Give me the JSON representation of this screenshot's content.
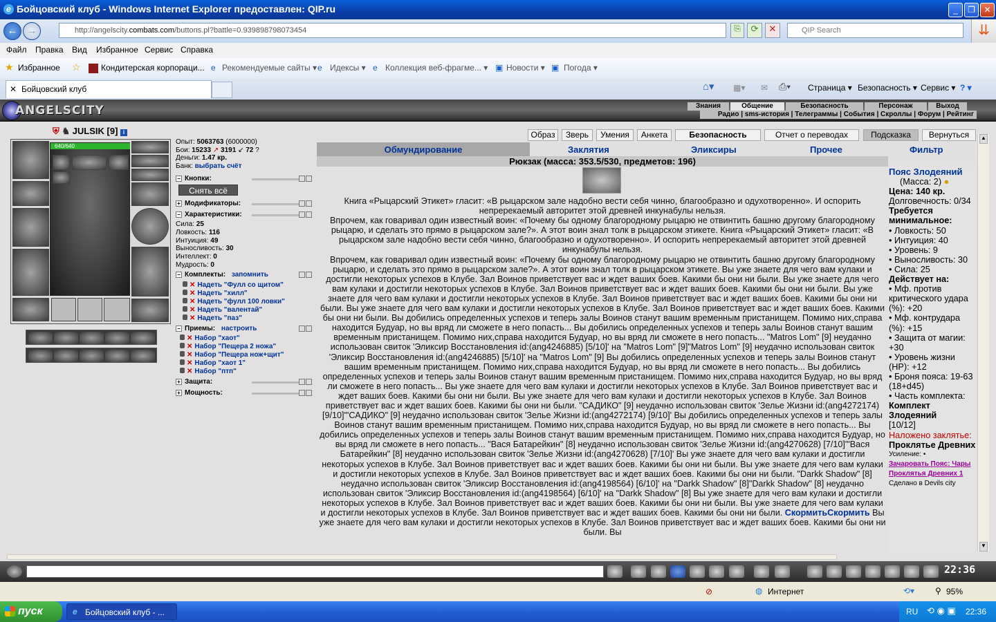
{
  "window": {
    "title": "Бойцовский клуб - Windows Internet Explorer предоставлен: QIP.ru",
    "min": "_",
    "max": "❐",
    "close": "✕"
  },
  "address": {
    "url_prefix": "http://angelscity.",
    "url_domain": "combats.com",
    "url_rest": "/buttons.pl?battle=0.939898798073454",
    "search_placeholder": "QIP Search"
  },
  "menu": [
    "Файл",
    "Правка",
    "Вид",
    "Избранное",
    "Сервис",
    "Справка"
  ],
  "favorites": {
    "label": "Избранное",
    "items": [
      "Кондитерская корпораци...",
      "Рекомендуемые сайты ▾",
      "Идексы ▾",
      "Коллекция веб-фрагме... ▾",
      "Новости ▾",
      "Погода ▾"
    ]
  },
  "tab": {
    "label": "Бойцовский клуб"
  },
  "commandbar": [
    "Страница ▾",
    "Безопасность ▾",
    "Сервис ▾",
    "? ▾"
  ],
  "game": {
    "logo": "ANGELSCITY",
    "topnav": [
      "Знания",
      "Общение",
      "Безопасность",
      "Персонаж",
      "Выход"
    ],
    "subnav": "Радио | sms-история | Телеграммы | События | Скроллы | Форум | Рейтинг",
    "player": {
      "name": "JULSIK",
      "level": "[9]",
      "hp": "640/640"
    },
    "stats": {
      "exp_label": "Опыт:",
      "exp": "5063763",
      "exp_next": "(6000000)",
      "fights_label": "Бои:",
      "wins": "15233",
      "losses": "3191",
      "draws": "72",
      "money_label": "Деньги:",
      "money": "1.47 кр.",
      "bank_label": "Банк:",
      "bank": "выбрать счёт"
    },
    "sections": {
      "buttons": "Кнопки:",
      "remove_all": "Снять всё",
      "modifiers": "Модификаторы:",
      "characteristics": "Характеристики:",
      "sets": "Комплекты:",
      "sets_remember": "запомнить",
      "tricks": "Приемы:",
      "tricks_config": "настроить",
      "defense": "Защита:",
      "power": "Мощность:"
    },
    "attributes": [
      {
        "label": "Сила:",
        "value": "25"
      },
      {
        "label": "Ловкость:",
        "value": "116"
      },
      {
        "label": "Интуиция:",
        "value": "49"
      },
      {
        "label": "Выносливость:",
        "value": "30"
      },
      {
        "label": "Интеллект:",
        "value": "0"
      },
      {
        "label": "Мудрость:",
        "value": "0"
      }
    ],
    "sets": [
      "Надеть \"Фулл со щитом\"",
      "Надеть \"хилл\"",
      "Надеть \"фулл 100 ловки\"",
      "Надеть \"валентай\"",
      "Надеть \"паз\""
    ],
    "tricks": [
      "Набор \"хаот\"",
      "Набор \"Пещера 2 ножа\"",
      "Набор \"Пещера нож+щит\"",
      "Набор \"хаот 1\"",
      "Набор \"птп\""
    ],
    "buttons": [
      "Образ",
      "Зверь",
      "Умения",
      "Анкета",
      "Безопасность",
      "Отчет о переводах",
      "Подсказка",
      "Вернуться"
    ],
    "inv_tabs": [
      "Обмундирование",
      "Заклятия",
      "Эликсиры",
      "Прочее",
      "Фильтр"
    ],
    "backpack": "Рюкзак (масса: 353.5/530, предметов: 196)",
    "description": [
      "Книга «Рыцарский Этикет» гласит: «В рыцарском зале надобно вести себя чинно, благообразно и одухотворенно». И оспорить непререкаемый авторитет этой древней инкунабулы нельзя.",
      "Впрочем, как говаривал один известный воин: «Почему бы одному благородному рыцарю не отвинтить башню другому благородному рыцарю, и сделать это прямо в рыцарском зале?». А этот воин знал толк в рыцарском этикете. Книга «Рыцарский Этикет» гласит: «В рыцарском зале надобно вести себя чинно, благообразно и одухотворенно». И оспорить непререкаемый авторитет этой древней инкунабулы нельзя.",
      "Впрочем, как говаривал один известный воин: «Почему бы одному благородному рыцарю не отвинтить башню другому благородному рыцарю, и сделать это прямо в рыцарском зале?». А этот воин знал толк в рыцарском этикете. Вы уже знаете для чего вам кулаки и достигли некоторых успехов в Клубе. Зал Воинов приветствует вас и ждет ваших боев. Какими бы они ни были. Вы уже знаете для чего вам кулаки и достигли некоторых успехов в Клубе. Зал Воинов приветствует вас и ждет ваших боев. Какими бы они ни были. Вы уже знаете для чего вам кулаки и достигли некоторых успехов в Клубе. Зал Воинов приветствует вас и ждет ваших боев. Какими бы они ни были. Вы уже знаете для чего вам кулаки и достигли некоторых успехов в Клубе. Зал Воинов приветствует вас и ждет ваших боев. Какими бы они ни были. Вы добились определенных успехов и теперь залы Воинов станут вашим временным пристанищем. Помимо них,справа находится Будуар, но вы вряд ли сможете в него попасть... Вы добились определенных успехов и теперь залы Воинов станут вашим временным пристанищем. Помимо них,справа находится Будуар, но вы вряд ли сможете в него попасть... \"Matros Lom\" [9] неудачно использован свиток 'Эликсир Восстановления id:(ang4246885) [5/10]' на \"Matros Lom\" [9]\"Matros Lom\" [9] неудачно использован свиток 'Эликсир Восстановления id:(ang4246885) [5/10]' на \"Matros Lom\" [9] Вы добились определенных успехов и теперь залы Воинов станут вашим временным пристанищем. Помимо них,справа находится Будуар, но вы вряд ли сможете в него попасть... Вы добились определенных успехов и теперь залы Воинов станут вашим временным пристанищем. Помимо них,справа находится Будуар, но вы вряд ли сможете в него попасть... Вы уже знаете для чего вам кулаки и достигли некоторых успехов в Клубе. Зал Воинов приветствует вас и ждет ваших боев. Какими бы они ни были. Вы уже знаете для чего вам кулаки и достигли некоторых успехов в Клубе. Зал Воинов приветствует вас и ждет ваших боев. Какими бы они ни были. \"САДИКО\" [9] неудачно использован свиток 'Зелье Жизни id:(ang4272174) [9/10]'\"САДИКО\" [9] неудачно использован свиток 'Зелье Жизни id:(ang4272174) [9/10]' Вы добились определенных успехов и теперь залы Воинов станут вашим временным пристанищем. Помимо них,справа находится Будуар, но вы вряд ли сможете в него попасть... Вы добились определенных успехов и теперь залы Воинов станут вашим временным пристанищем. Помимо них,справа находится Будуар, но вы вряд ли сможете в него попасть... \"Вася Батарейкин\" [8] неудачно использован свиток 'Зелье Жизни id:(ang4270628) [7/10]'\"Вася Батарейкин\" [8] неудачно использован свиток 'Зелье Жизни id:(ang4270628) [7/10]' Вы уже знаете для чего вам кулаки и достигли некоторых успехов в Клубе. Зал Воинов приветствует вас и ждет ваших боев. Какими бы они ни были. Вы уже знаете для чего вам кулаки и достигли некоторых успехов в Клубе. Зал Воинов приветствует вас и ждет ваших боев. Какими бы они ни были. \"Darkk Shadow\" [8] неудачно использован свиток 'Эликсир Восстановления id:(ang4198564) [6/10]' на \"Darkk Shadow\" [8]\"Darkk Shadow\" [8] неудачно использован свиток 'Эликсир Восстановления id:(ang4198564) [6/10]' на \"Darkk Shadow\" [8] Вы уже знаете для чего вам кулаки и достигли некоторых успехов в Клубе. Зал Воинов приветствует вас и ждет ваших боев. Какими бы они ни были. Вы уже знаете для чего вам кулаки и достигли некоторых успехов в Клубе. Зал Воинов приветствует вас и ждет ваших боев. Какими бы они ни были."
    ],
    "desc_link": "СкормитьСкормить",
    "desc_tail": "Вы уже знаете для чего вам кулаки и достигли некоторых успехов в Клубе. Зал Воинов приветствует вас и ждет ваших боев. Какими бы они ни были. Вы",
    "item": {
      "name": "Пояс Злодеяний",
      "mass": "(Масса: 2)",
      "price": "Цена: 140 кр.",
      "durability": "Долговечность: 0/34",
      "requires": "Требуется минимальное:",
      "req": [
        "• Ловкость: 50",
        "• Интуиция: 40",
        "• Уровень: 9",
        "• Выносливость: 30",
        "• Сила: 25"
      ],
      "acts": "Действует на:",
      "effects": [
        "• Мф. против критического удара (%): +20",
        "• Мф. контрудара (%): +15",
        "• Защита от магии: +30",
        "• Уровень жизни (HP): +12",
        "• Броня пояса: 19-63 (18+d45)",
        "• Часть комплекта:"
      ],
      "set_name": "Комплект Злодеяний",
      "set_count": "[10/12]",
      "curse_label": "Наложено заклятье:",
      "curse": "Проклятье Древних",
      "boost": "Усиление: •",
      "link1": "Зачаровать Пояс: Чары Проклятья Древних 1",
      "made_in": "Сделано в Devils city"
    },
    "clock": "22:36"
  },
  "status": {
    "zone": "Интернет",
    "zoom": "95%"
  },
  "taskbar": {
    "start": "пуск",
    "task": "Бойцовский клуб - ...",
    "lang": "RU",
    "time": "22:36"
  }
}
